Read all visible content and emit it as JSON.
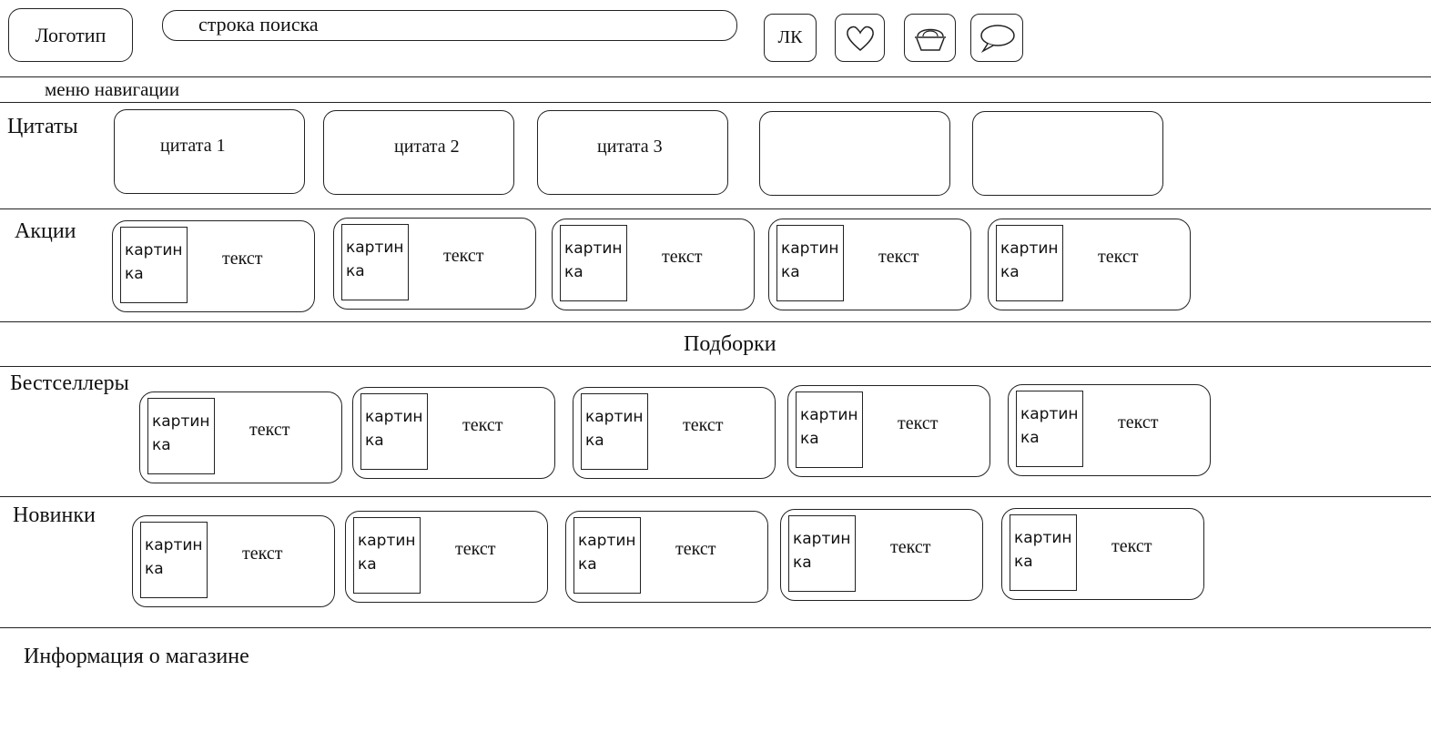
{
  "header": {
    "logo": "Логотип",
    "search": "строка поиска",
    "account": "ЛК",
    "icons": [
      "heart-icon",
      "basket-icon",
      "chat-icon"
    ]
  },
  "nav": {
    "label": "меню навигации"
  },
  "quotes": {
    "label": "Цитаты",
    "items": [
      "цитата 1",
      "цитата 2",
      "цитата 3",
      "",
      ""
    ]
  },
  "promos": {
    "label": "Акции",
    "cards": [
      {
        "picture": "картинка",
        "text": "текст"
      },
      {
        "picture": "картинка",
        "text": "текст"
      },
      {
        "picture": "картинка",
        "text": "текст"
      },
      {
        "picture": "картинка",
        "text": "текст"
      },
      {
        "picture": "картинка",
        "text": "текст"
      }
    ]
  },
  "collections": {
    "label": "Подборки"
  },
  "bestsellers": {
    "label": "Бестселлеры",
    "cards": [
      {
        "picture": "картинка",
        "text": "текст"
      },
      {
        "picture": "картинка",
        "text": "текст"
      },
      {
        "picture": "картинка",
        "text": "текст"
      },
      {
        "picture": "картинка",
        "text": "текст"
      },
      {
        "picture": "картинка",
        "text": "текст"
      }
    ]
  },
  "new_arrivals": {
    "label": "Новинки",
    "cards": [
      {
        "picture": "картинка",
        "text": "текст"
      },
      {
        "picture": "картинка",
        "text": "текст"
      },
      {
        "picture": "картинка",
        "text": "текст"
      },
      {
        "picture": "картинка",
        "text": "текст"
      },
      {
        "picture": "картинка",
        "text": "текст"
      }
    ]
  },
  "footer": {
    "label": "Информация о магазине"
  }
}
